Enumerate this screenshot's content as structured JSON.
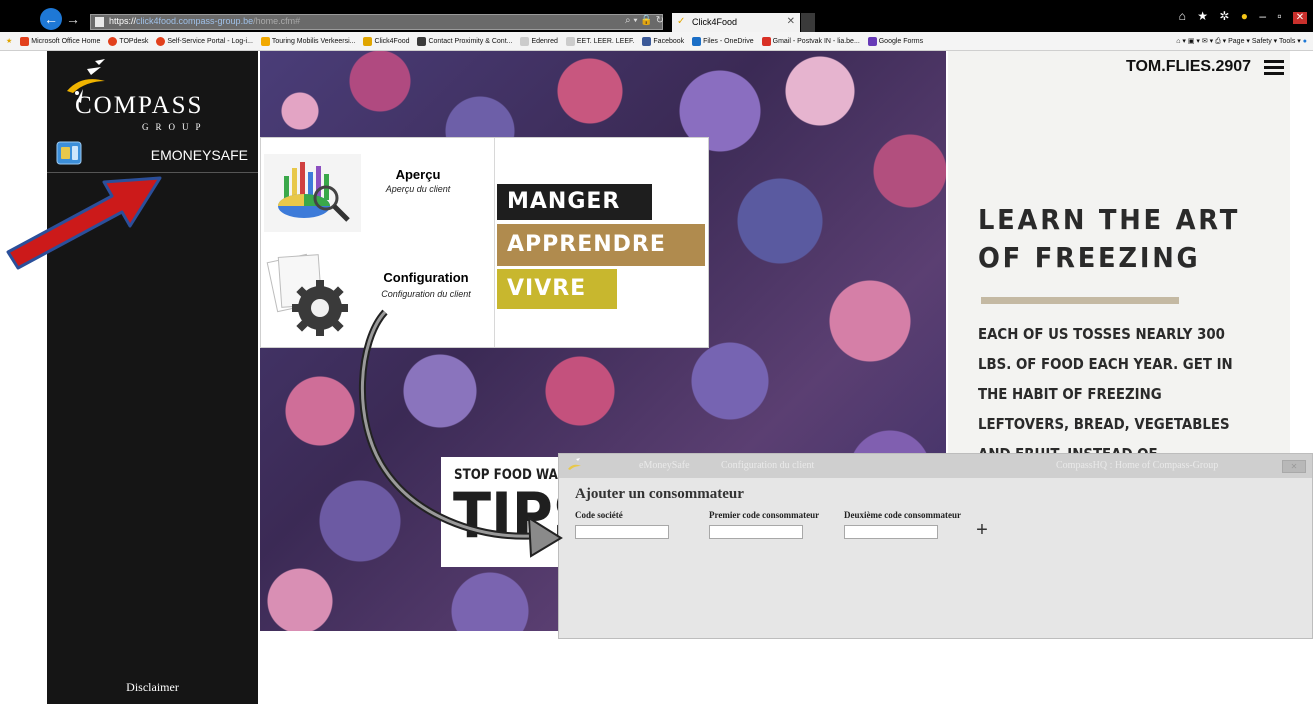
{
  "browser": {
    "url_prefix": "https://",
    "url_host": "click4food.compass-group.be",
    "url_path": "/home.cfm#",
    "tab_title": "Click4Food",
    "bookmarks": [
      "Microsoft Office Home",
      "TOPdesk",
      "Self-Service Portal - Log-i...",
      "Touring Mobilis Verkeersi...",
      "Click4Food",
      "Contact Proximity & Cont...",
      "Edenred",
      "EET. LEER. LEEF.",
      "Facebook",
      "Files - OneDrive",
      "Gmail - Postvak IN - lia.be...",
      "Google Forms"
    ],
    "ie_tools": "Page ▾   Safety ▾   Tools ▾"
  },
  "sidebar": {
    "logo_word": "COMPASS",
    "logo_sub": "GROUP",
    "menu_label": "EMONEYSAFE",
    "disclaimer": "Disclaimer"
  },
  "header": {
    "user": "TOM.FLIES.2907"
  },
  "popup": {
    "apercu_title": "Aperçu",
    "apercu_sub": "Aperçu du client",
    "config_title": "Configuration",
    "config_sub": "Configuration du client",
    "tag_manger": "MANGER",
    "tag_apprendre": "APPRENDRE",
    "tag_vivre": "VIVRE"
  },
  "promo": {
    "heading": "LEARN THE ART OF FREEZING",
    "body": "EACH OF US TOSSES NEARLY 300 LBS. OF FOOD EACH YEAR. GET IN THE HABIT OF FREEZING LEFTOVERS, BREAD, VEGETABLES AND FRUIT, INSTEAD OF",
    "tips_stop": "STOP FOOD WA",
    "tips_big": "TIPS"
  },
  "dialog": {
    "crumb1": "eMoneySafe",
    "crumb2": "Configuration du client",
    "right_title": "CompassHQ : Home of Compass-Group",
    "heading": "Ajouter un consommateur",
    "label_company": "Code société",
    "label_first": "Premier code consommateur",
    "label_second": "Deuxième code consommateur",
    "add_symbol": "+"
  },
  "colors": {
    "sidebar_bg": "#151515",
    "tag_manger": "#1e1e1e",
    "tag_apprendre": "#b08b4e",
    "tag_vivre": "#c8b72e",
    "annotation_red": "#cc1a1a"
  }
}
